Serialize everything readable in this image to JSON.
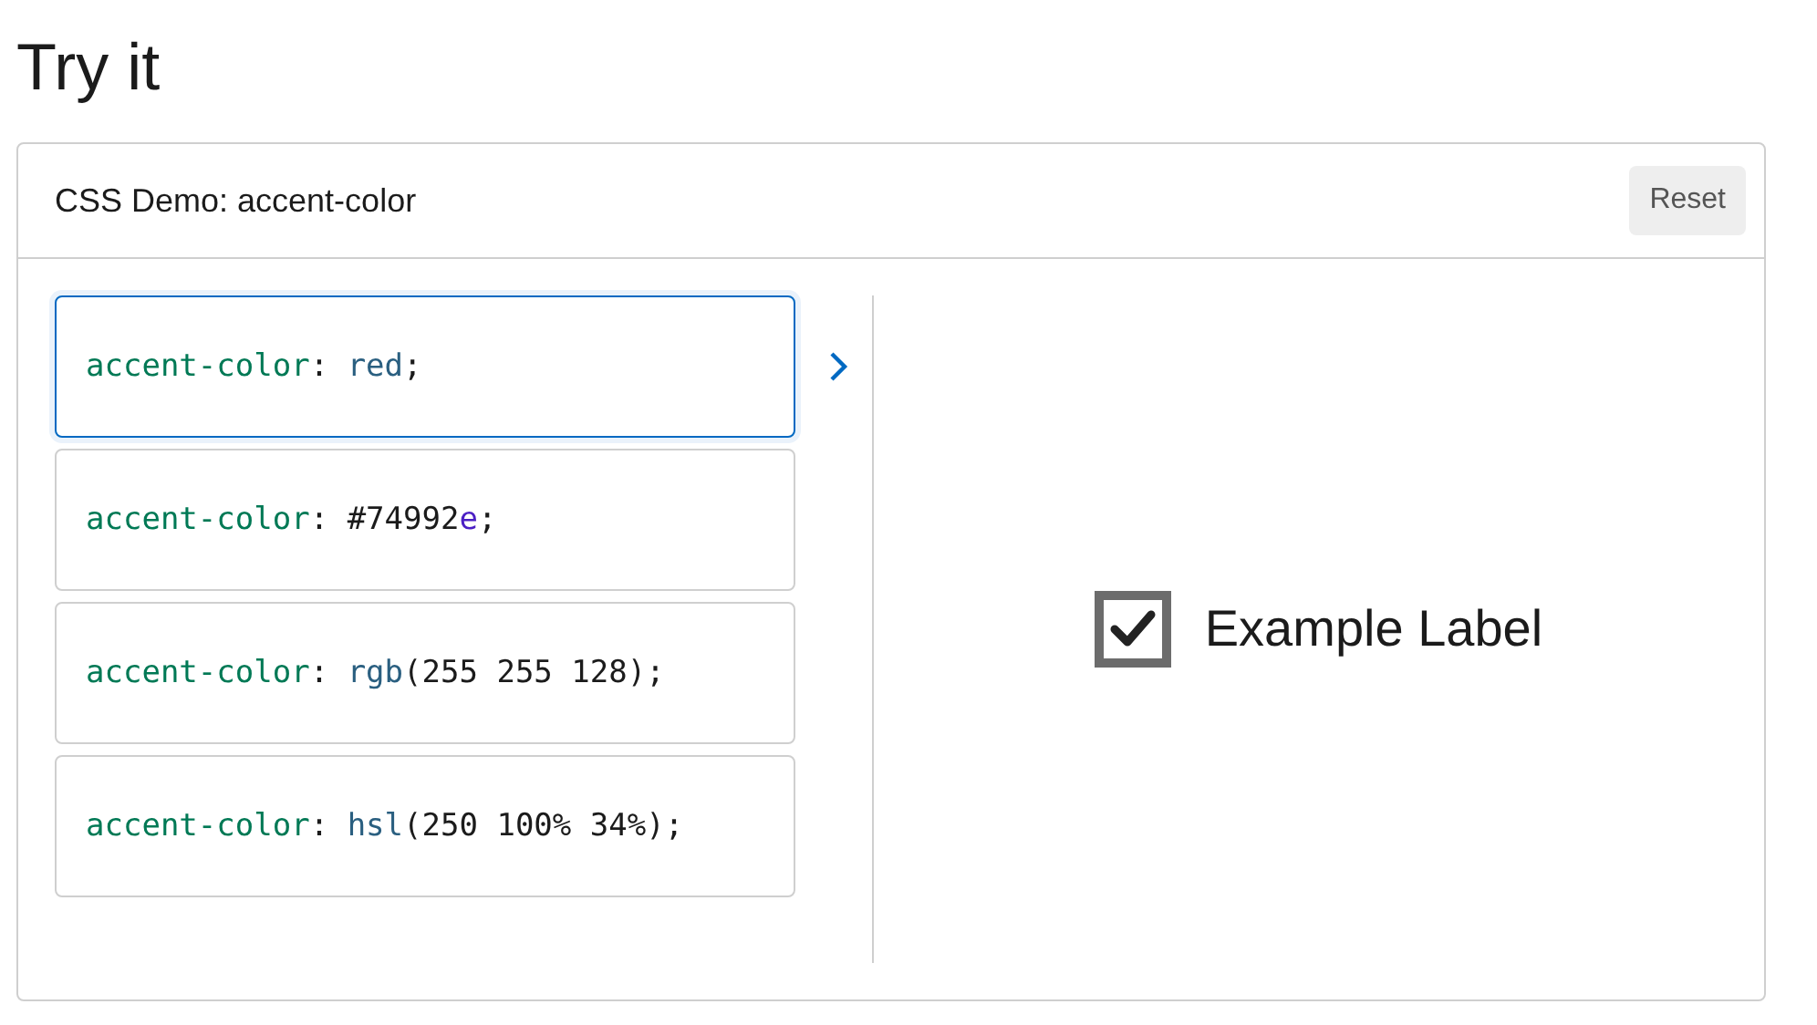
{
  "heading": "Try it",
  "demo": {
    "title": "CSS Demo: accent-color",
    "reset_label": "Reset",
    "options": [
      {
        "selected": true,
        "tokens": [
          {
            "kind": "property",
            "text": "accent-color"
          },
          {
            "kind": "punct",
            "text": ": "
          },
          {
            "kind": "func",
            "text": "red"
          },
          {
            "kind": "punct",
            "text": ";"
          }
        ]
      },
      {
        "selected": false,
        "tokens": [
          {
            "kind": "property",
            "text": "accent-color"
          },
          {
            "kind": "punct",
            "text": ": "
          },
          {
            "kind": "plain",
            "text": "#74992"
          },
          {
            "kind": "keyword",
            "text": "e"
          },
          {
            "kind": "punct",
            "text": ";"
          }
        ]
      },
      {
        "selected": false,
        "tokens": [
          {
            "kind": "property",
            "text": "accent-color"
          },
          {
            "kind": "punct",
            "text": ": "
          },
          {
            "kind": "func",
            "text": "rgb"
          },
          {
            "kind": "plain",
            "text": "(255 255 128);"
          }
        ]
      },
      {
        "selected": false,
        "tokens": [
          {
            "kind": "property",
            "text": "accent-color"
          },
          {
            "kind": "punct",
            "text": ": "
          },
          {
            "kind": "func",
            "text": "hsl"
          },
          {
            "kind": "plain",
            "text": "(250 100% 34%);"
          }
        ]
      }
    ],
    "preview": {
      "checked": true,
      "label": "Example Label"
    }
  }
}
